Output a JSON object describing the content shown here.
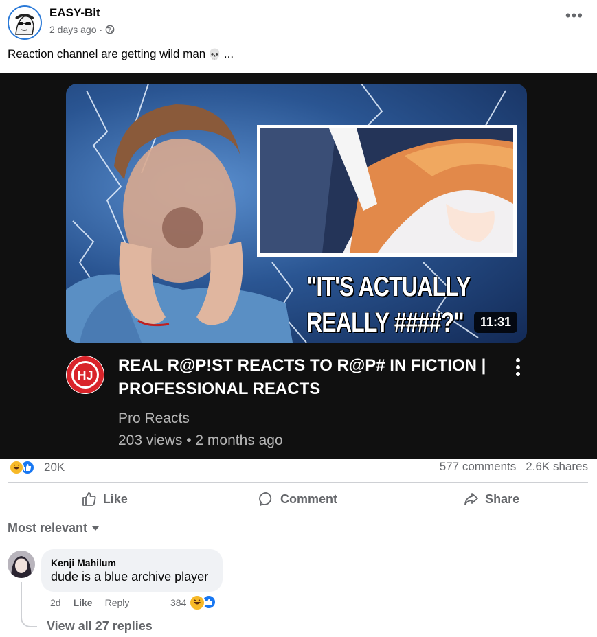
{
  "post": {
    "author": "EASY-Bit",
    "time": "2 days ago",
    "separator": "·",
    "caption": "Reaction channel are getting wild man",
    "caption_suffix": "...",
    "more": "•••"
  },
  "video": {
    "quote_line1": "\"IT'S ACTUALLY",
    "quote_line2": "REALLY ####?\"",
    "duration": "11:31",
    "title_line1": "REAL R@P!ST REACTS TO R@P# IN FICTION |",
    "title_line2": "PROFESSIONAL REACTS",
    "channel": "Pro Reacts",
    "stats": "203 views • 2 months ago"
  },
  "reactions": {
    "count": "20K",
    "comments": "577 comments",
    "shares": "2.6K shares"
  },
  "actions": {
    "like": "Like",
    "comment": "Comment",
    "share": "Share"
  },
  "comments": {
    "sort_label": "Most relevant",
    "items": [
      {
        "name": "Kenji Mahilum",
        "text": "dude is a blue archive player",
        "time": "2d",
        "like": "Like",
        "reply": "Reply",
        "react_count": "384"
      }
    ],
    "view_replies": "View all 27 replies"
  },
  "colors": {
    "fb_blue": "#1877f2",
    "muted": "#65676b",
    "haha_yellow": "#f7b928"
  }
}
